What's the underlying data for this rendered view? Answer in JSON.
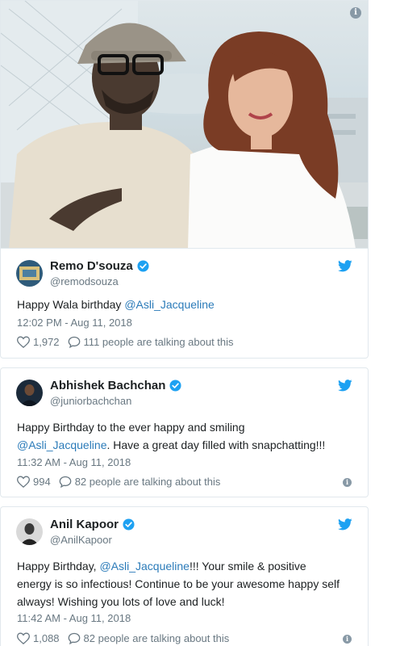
{
  "colors": {
    "link": "#2b7bb9",
    "twitter_blue": "#1da1f2",
    "muted": "#697882",
    "border": "#e1e8ed"
  },
  "photo": {
    "info_icon": "i"
  },
  "tweets": [
    {
      "name": "Remo D'souza",
      "handle": "@remodsouza",
      "text_parts": [
        "Happy Wala birthday ",
        "@Asli_Jacqueline"
      ],
      "time": "12:02 PM - Aug 11, 2018",
      "likes": "1,972",
      "talking": "111 people are talking about this",
      "icons": [
        "verified-icon",
        "twitter-bird-icon",
        "heart-icon",
        "speech-bubble-icon"
      ]
    },
    {
      "name": "Abhishek Bachchan",
      "handle": "@juniorbachchan",
      "text_line1": "Happy Birthday to the ever happy and smiling",
      "text_mention": "@Asli_Jacqueline",
      "text_rest": ". Have a great day filled with snapchatting!!!",
      "time": "11:32 AM - Aug 11, 2018",
      "likes": "994",
      "talking": "82 people are talking about this",
      "icons": [
        "verified-icon",
        "twitter-bird-icon",
        "heart-icon",
        "speech-bubble-icon",
        "info-icon"
      ]
    },
    {
      "name": "Anil Kapoor",
      "handle": "@AnilKapoor",
      "text_prefix": "Happy Birthday, ",
      "text_mention": "@Asli_Jacqueline",
      "text_rest1": "!!! Your smile & positive",
      "text_line2": "energy is so infectious! Continue to be your awesome happy self",
      "text_line3": "always! Wishing you lots of love and luck!",
      "time": "11:42 AM - Aug 11, 2018",
      "likes": "1,088",
      "talking": "82 people are talking about this",
      "icons": [
        "verified-icon",
        "twitter-bird-icon",
        "heart-icon",
        "speech-bubble-icon",
        "info-icon"
      ]
    }
  ]
}
